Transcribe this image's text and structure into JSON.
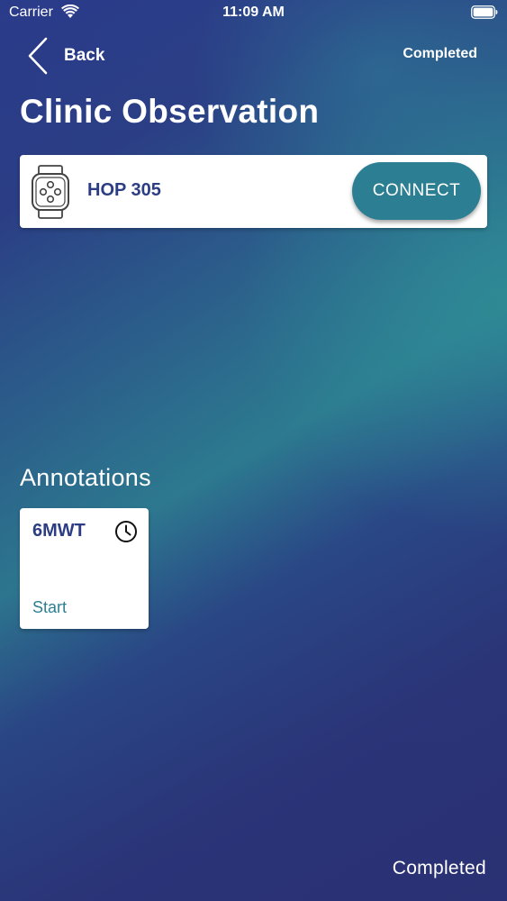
{
  "status_bar": {
    "carrier": "Carrier",
    "time": "11:09 AM"
  },
  "nav": {
    "back_label": "Back",
    "completed_label": "Completed"
  },
  "page_title": "Clinic Observation",
  "device": {
    "name": "HOP 305",
    "connect_label": "CONNECT",
    "icon": "smartwatch-icon"
  },
  "annotations": {
    "title": "Annotations",
    "items": [
      {
        "name": "6MWT",
        "action_label": "Start",
        "icon": "clock-icon"
      }
    ]
  },
  "footer": {
    "completed_label": "Completed"
  },
  "colors": {
    "accent": "#2c7f93",
    "text_dark": "#2d3d84",
    "white": "#ffffff"
  }
}
